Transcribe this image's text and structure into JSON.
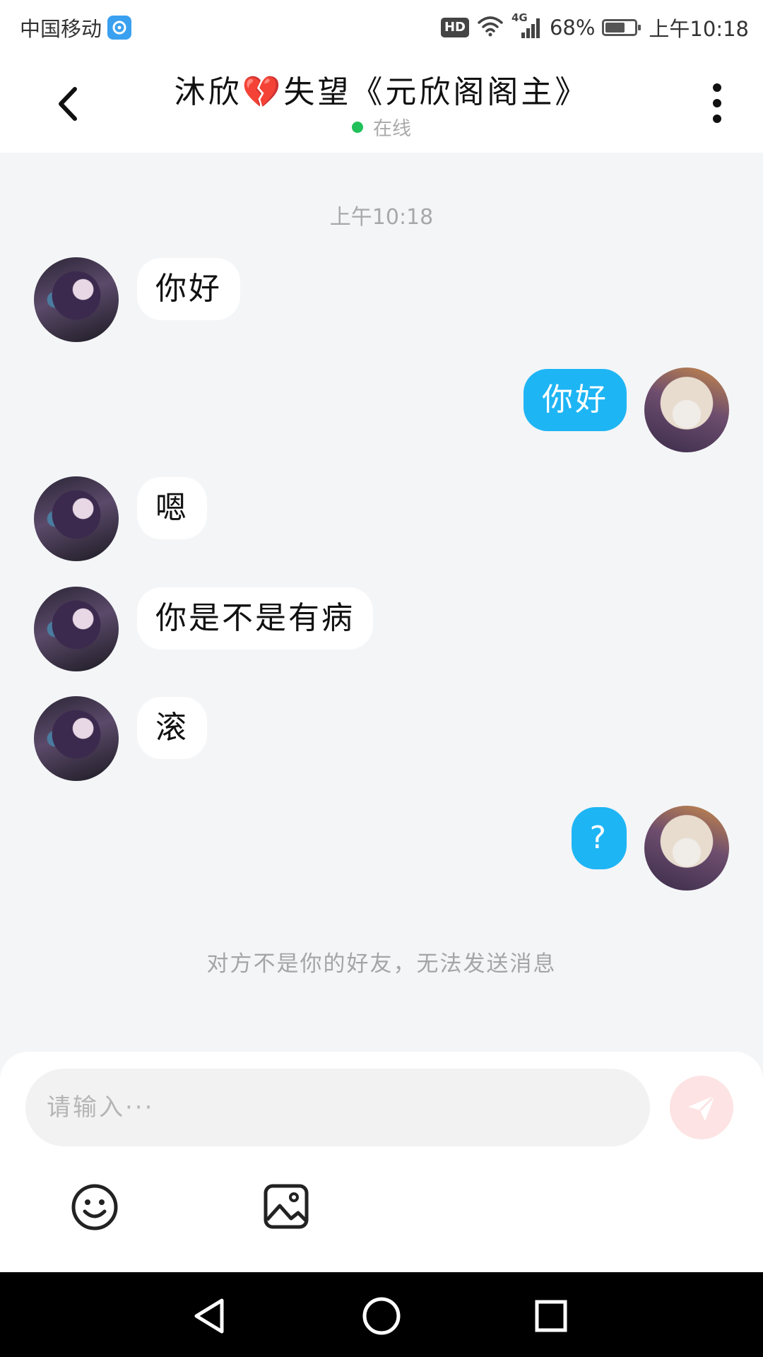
{
  "status_bar": {
    "carrier": "中国移动",
    "hd": "HD",
    "network": "4G",
    "battery_percent": "68%",
    "battery_level": 0.68,
    "time": "上午10:18"
  },
  "header": {
    "title": "沐欣💔失望《元欣阁阁主》",
    "status": "在线",
    "status_color": "#21c05a"
  },
  "chat": {
    "timestamp": "上午10:18",
    "messages": [
      {
        "side": "left",
        "text": "你好"
      },
      {
        "side": "right",
        "text": "你好"
      },
      {
        "side": "left",
        "text": "嗯"
      },
      {
        "side": "left",
        "text": "你是不是有病"
      },
      {
        "side": "left",
        "text": "滚"
      },
      {
        "side": "right",
        "text": "?"
      }
    ],
    "notice": "对方不是你的好友，无法发送消息"
  },
  "input": {
    "placeholder": "请输入···",
    "value": ""
  },
  "icons": {
    "back": "back-arrow-icon",
    "more": "more-vertical-icon",
    "send": "send-icon",
    "emoji": "emoji-icon",
    "image": "image-icon",
    "nav_back": "nav-back-icon",
    "nav_home": "nav-home-icon",
    "nav_recent": "nav-recents-icon"
  },
  "colors": {
    "bubble_self": "#1eb5f4",
    "bubble_other": "#ffffff",
    "send_button": "#fde3e3",
    "background": "#f4f5f7"
  }
}
